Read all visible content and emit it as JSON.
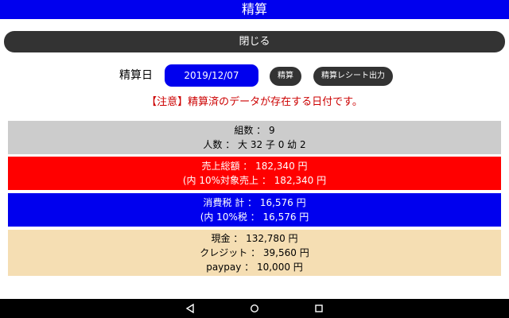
{
  "header": {
    "title": "精算"
  },
  "close_label": "閉じる",
  "settlement": {
    "date_label": "精算日",
    "date_value": "2019/12/07",
    "settle_label": "精算",
    "receipt_label": "精算レシート出力"
  },
  "notice": "【注意】精算済のデータが存在する日付です。",
  "groups": {
    "line1": "組数 ： 9",
    "line2": "人数 ： 大 32  子 0  幼 2"
  },
  "sales": {
    "line1": "売上総額 ： 182,340 円",
    "line2": "(内 10%対象売上 ： 182,340 円"
  },
  "tax": {
    "line1": "消費税 計 ： 16,576 円",
    "line2": "(内 10%税 ： 16,576 円"
  },
  "payments": {
    "line1": "現金 ： 132,780 円",
    "line2": "クレジット ： 39,560 円",
    "line3": "paypay ： 10,000 円"
  },
  "nav_icons": [
    "back-icon",
    "home-icon",
    "recents-icon"
  ],
  "colors": {
    "primary_blue": "#0000ee",
    "dark_button": "#333333",
    "notice_red": "#cc0000",
    "sales_red": "#ff0000",
    "gray_panel": "#cccccc",
    "beige_panel": "#f5deb3"
  }
}
